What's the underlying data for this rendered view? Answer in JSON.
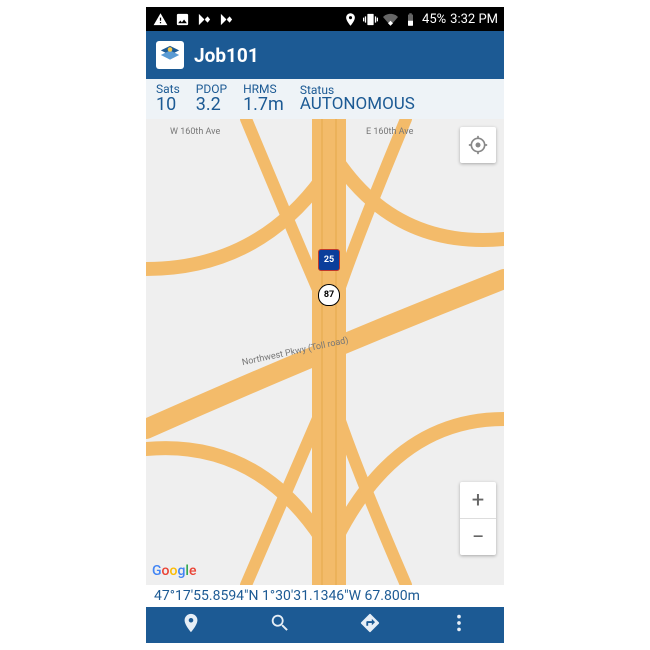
{
  "statusbar": {
    "battery": "45%",
    "time": "3:32 PM"
  },
  "appbar": {
    "title": "Job101"
  },
  "stats": {
    "sats": {
      "label": "Sats",
      "value": "10"
    },
    "pdop": {
      "label": "PDOP",
      "value": "3.2"
    },
    "hrms": {
      "label": "HRMS",
      "value": "1.7m"
    },
    "status": {
      "label": "Status",
      "value": "AUTONOMOUS"
    }
  },
  "map": {
    "labels": {
      "w160": "W 160th Ave",
      "e160": "E 160th Ave",
      "nwpkwy": "Northwest Pkwy (Toll road)",
      "i25": "25",
      "us87": "87"
    },
    "attribution": "Google",
    "zoom_in": "+",
    "zoom_out": "−"
  },
  "coords": {
    "text": "47°17'55.8594\"N  1°30'31.1346\"W  67.800m"
  }
}
